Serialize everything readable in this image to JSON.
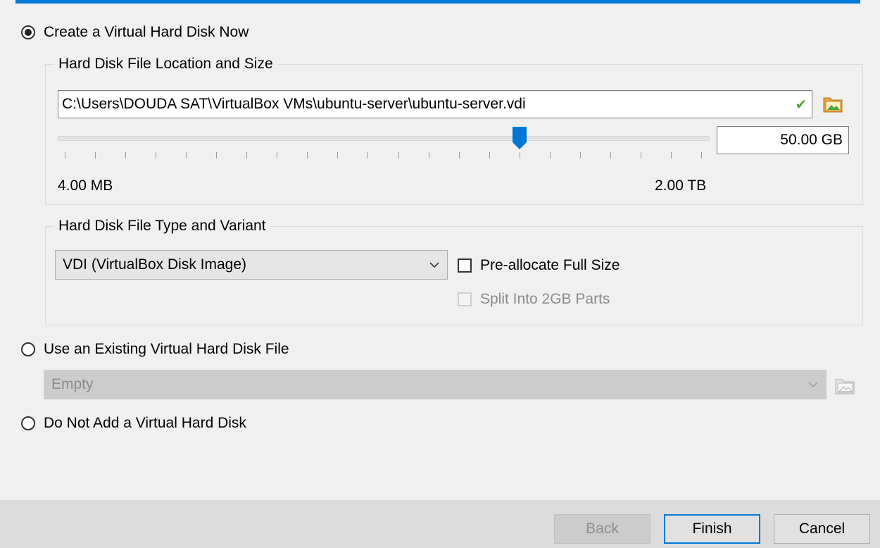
{
  "options": {
    "create_new": {
      "label": "Create a Virtual Hard Disk Now",
      "selected": true
    },
    "use_existing": {
      "label": "Use an Existing Virtual Hard Disk File",
      "selected": false
    },
    "do_not_add": {
      "label": "Do Not Add a Virtual Hard Disk",
      "selected": false
    }
  },
  "location_group": {
    "title": "Hard Disk File Location and Size",
    "path": "C:\\Users\\DOUDA SAT\\VirtualBox VMs\\ubuntu-server\\ubuntu-server.vdi",
    "size_value": "50.00 GB",
    "slider_min_label": "4.00 MB",
    "slider_max_label": "2.00 TB",
    "slider_fraction": 0.71
  },
  "type_group": {
    "title": "Hard Disk File Type and Variant",
    "file_type": "VDI (VirtualBox Disk Image)",
    "preallocate_label": "Pre-allocate Full Size",
    "preallocate_checked": false,
    "split_label": "Split Into 2GB Parts",
    "split_checked": false,
    "split_enabled": false
  },
  "existing_disk": {
    "value": "Empty",
    "enabled": false
  },
  "buttons": {
    "back": "Back",
    "finish": "Finish",
    "cancel": "Cancel"
  },
  "colors": {
    "accent": "#0078d7",
    "valid_check": "#5ba234"
  },
  "icons": [
    "check-valid-icon",
    "folder-icon",
    "chevron-down-icon",
    "slider-handle-icon"
  ]
}
